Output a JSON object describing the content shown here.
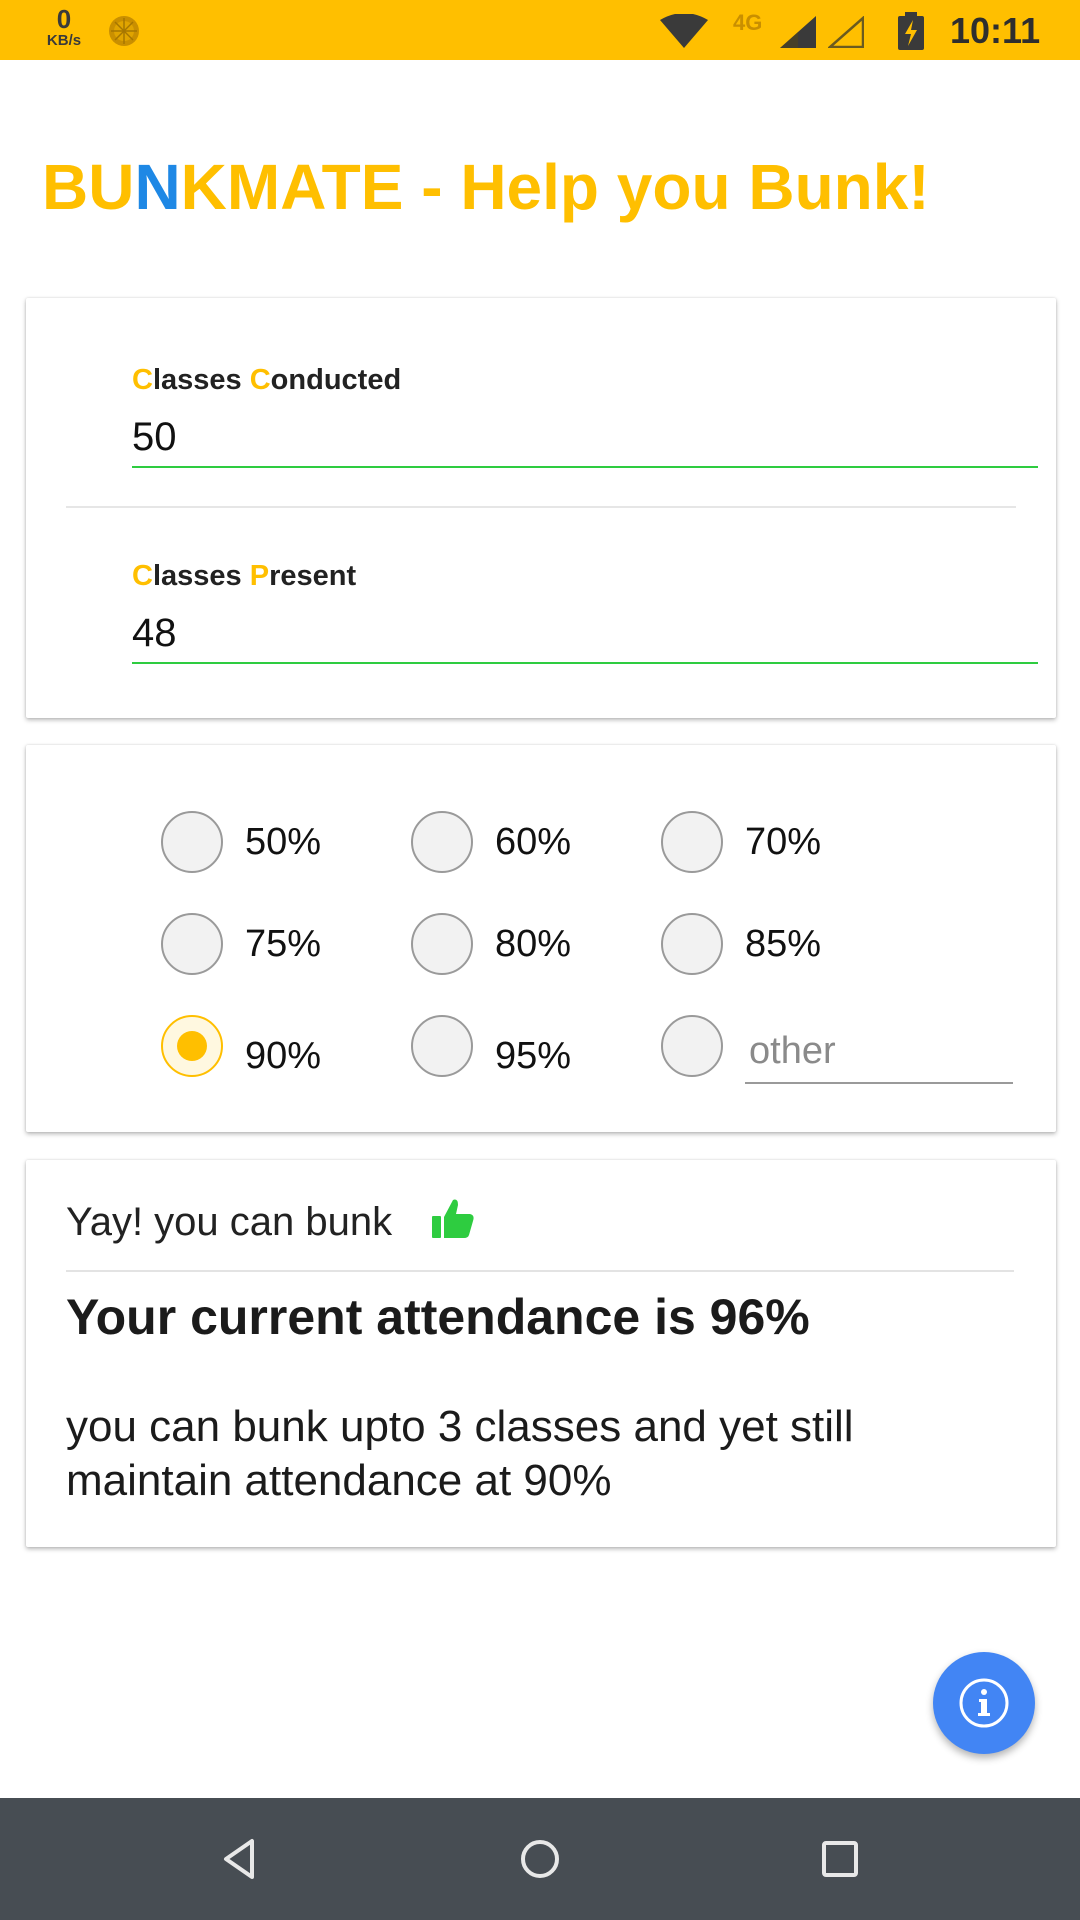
{
  "status_bar": {
    "speed_value": "0",
    "speed_unit": "KB/s",
    "network_type": "4G",
    "time": "10:11",
    "icons": [
      "sun-icon",
      "wifi-icon",
      "signal-icon",
      "signal-empty-icon",
      "battery-charging-icon"
    ],
    "background": "#ffbf00"
  },
  "header": {
    "title_part1": "BU",
    "title_accent": "N",
    "title_part2": "KMATE - Help you Bunk!",
    "title_color": "#ffbf00",
    "accent_color": "#1e88e5"
  },
  "inputs": {
    "conducted": {
      "label_initial1": "C",
      "label_rest1": "lasses ",
      "label_initial2": "C",
      "label_rest2": "onducted",
      "value": "50"
    },
    "present": {
      "label_initial1": "C",
      "label_rest1": "lasses ",
      "label_initial2": "P",
      "label_rest2": "resent",
      "value": "48"
    },
    "underline_color": "#2ecc40"
  },
  "targets": {
    "options": [
      "50%",
      "60%",
      "70%",
      "75%",
      "80%",
      "85%",
      "90%",
      "95%"
    ],
    "selected": "90%",
    "other_placeholder": "other",
    "selected_color": "#ffbf00"
  },
  "result": {
    "status_text": "Yay! you can bunk",
    "status_icon": "thumbs-up-icon",
    "attendance_text": "Your current attendance is 96%",
    "message": "you can bunk upto 3 classes and yet still maintain attendance at 90%"
  },
  "fab": {
    "icon": "info-icon",
    "color": "#4285f4"
  },
  "nav_bar": {
    "icons": [
      "back-icon",
      "home-icon",
      "recents-icon"
    ]
  }
}
